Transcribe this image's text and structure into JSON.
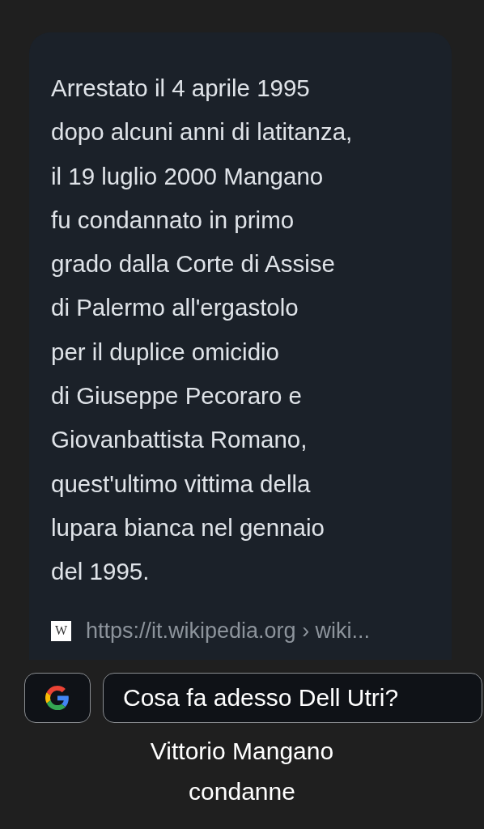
{
  "answer_card": {
    "paragraph_lines": [
      "Arrestato il 4 aprile 1995",
      "dopo alcuni anni di latitanza,",
      "il 19 luglio 2000 Mangano",
      "fu condannato in primo",
      "grado dalla Corte di Assise",
      "di Palermo all'ergastolo",
      "per il duplice omicidio",
      "di Giuseppe Pecoraro e",
      "Giovanbattista Romano,",
      "quest'ultimo vittima della",
      "lupara bianca nel gennaio",
      "del 1995."
    ],
    "source": {
      "favicon": "W",
      "url": "https://it.wikipedia.org › wiki..."
    }
  },
  "chips": [
    {
      "kind": "google"
    },
    {
      "kind": "query",
      "label": "Cosa fa adesso Dell Utri?"
    }
  ],
  "suggestion": "Vittorio Mangano condanne"
}
